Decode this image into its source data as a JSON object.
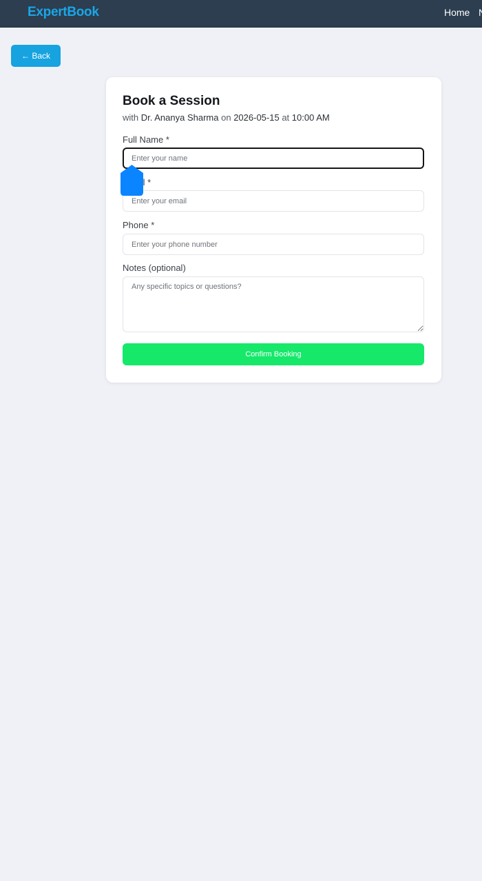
{
  "navbar": {
    "brand": "ExpertBook",
    "home_label": "Home",
    "more_label": "N"
  },
  "back_label": "← Back",
  "booking": {
    "title": "Book a Session",
    "subtitle_with": "with",
    "expert_name": "Dr. Ananya Sharma",
    "subtitle_on": "on",
    "date": "2026-05-15",
    "subtitle_at": "at",
    "time": "10:00 AM",
    "fields": {
      "full_name": {
        "label": "Full Name *",
        "placeholder": "Enter your name",
        "value": ""
      },
      "email": {
        "label": "Email *",
        "placeholder": "Enter your email",
        "value": ""
      },
      "phone": {
        "label": "Phone *",
        "placeholder": "Enter your phone number",
        "value": ""
      },
      "notes": {
        "label": "Notes (optional)",
        "placeholder": "Any specific topics or questions?",
        "value": ""
      }
    },
    "submit_label": "Confirm Booking"
  },
  "colors": {
    "navbar_bg": "#2c3e50",
    "brand": "#1aa6e8",
    "back_button": "#16a3e0",
    "confirm_button": "#16e86a",
    "page_bg": "#f0f1f7",
    "cursor_marker": "#0a84ff"
  },
  "icons": {
    "cursor": "touch-cursor-icon"
  }
}
